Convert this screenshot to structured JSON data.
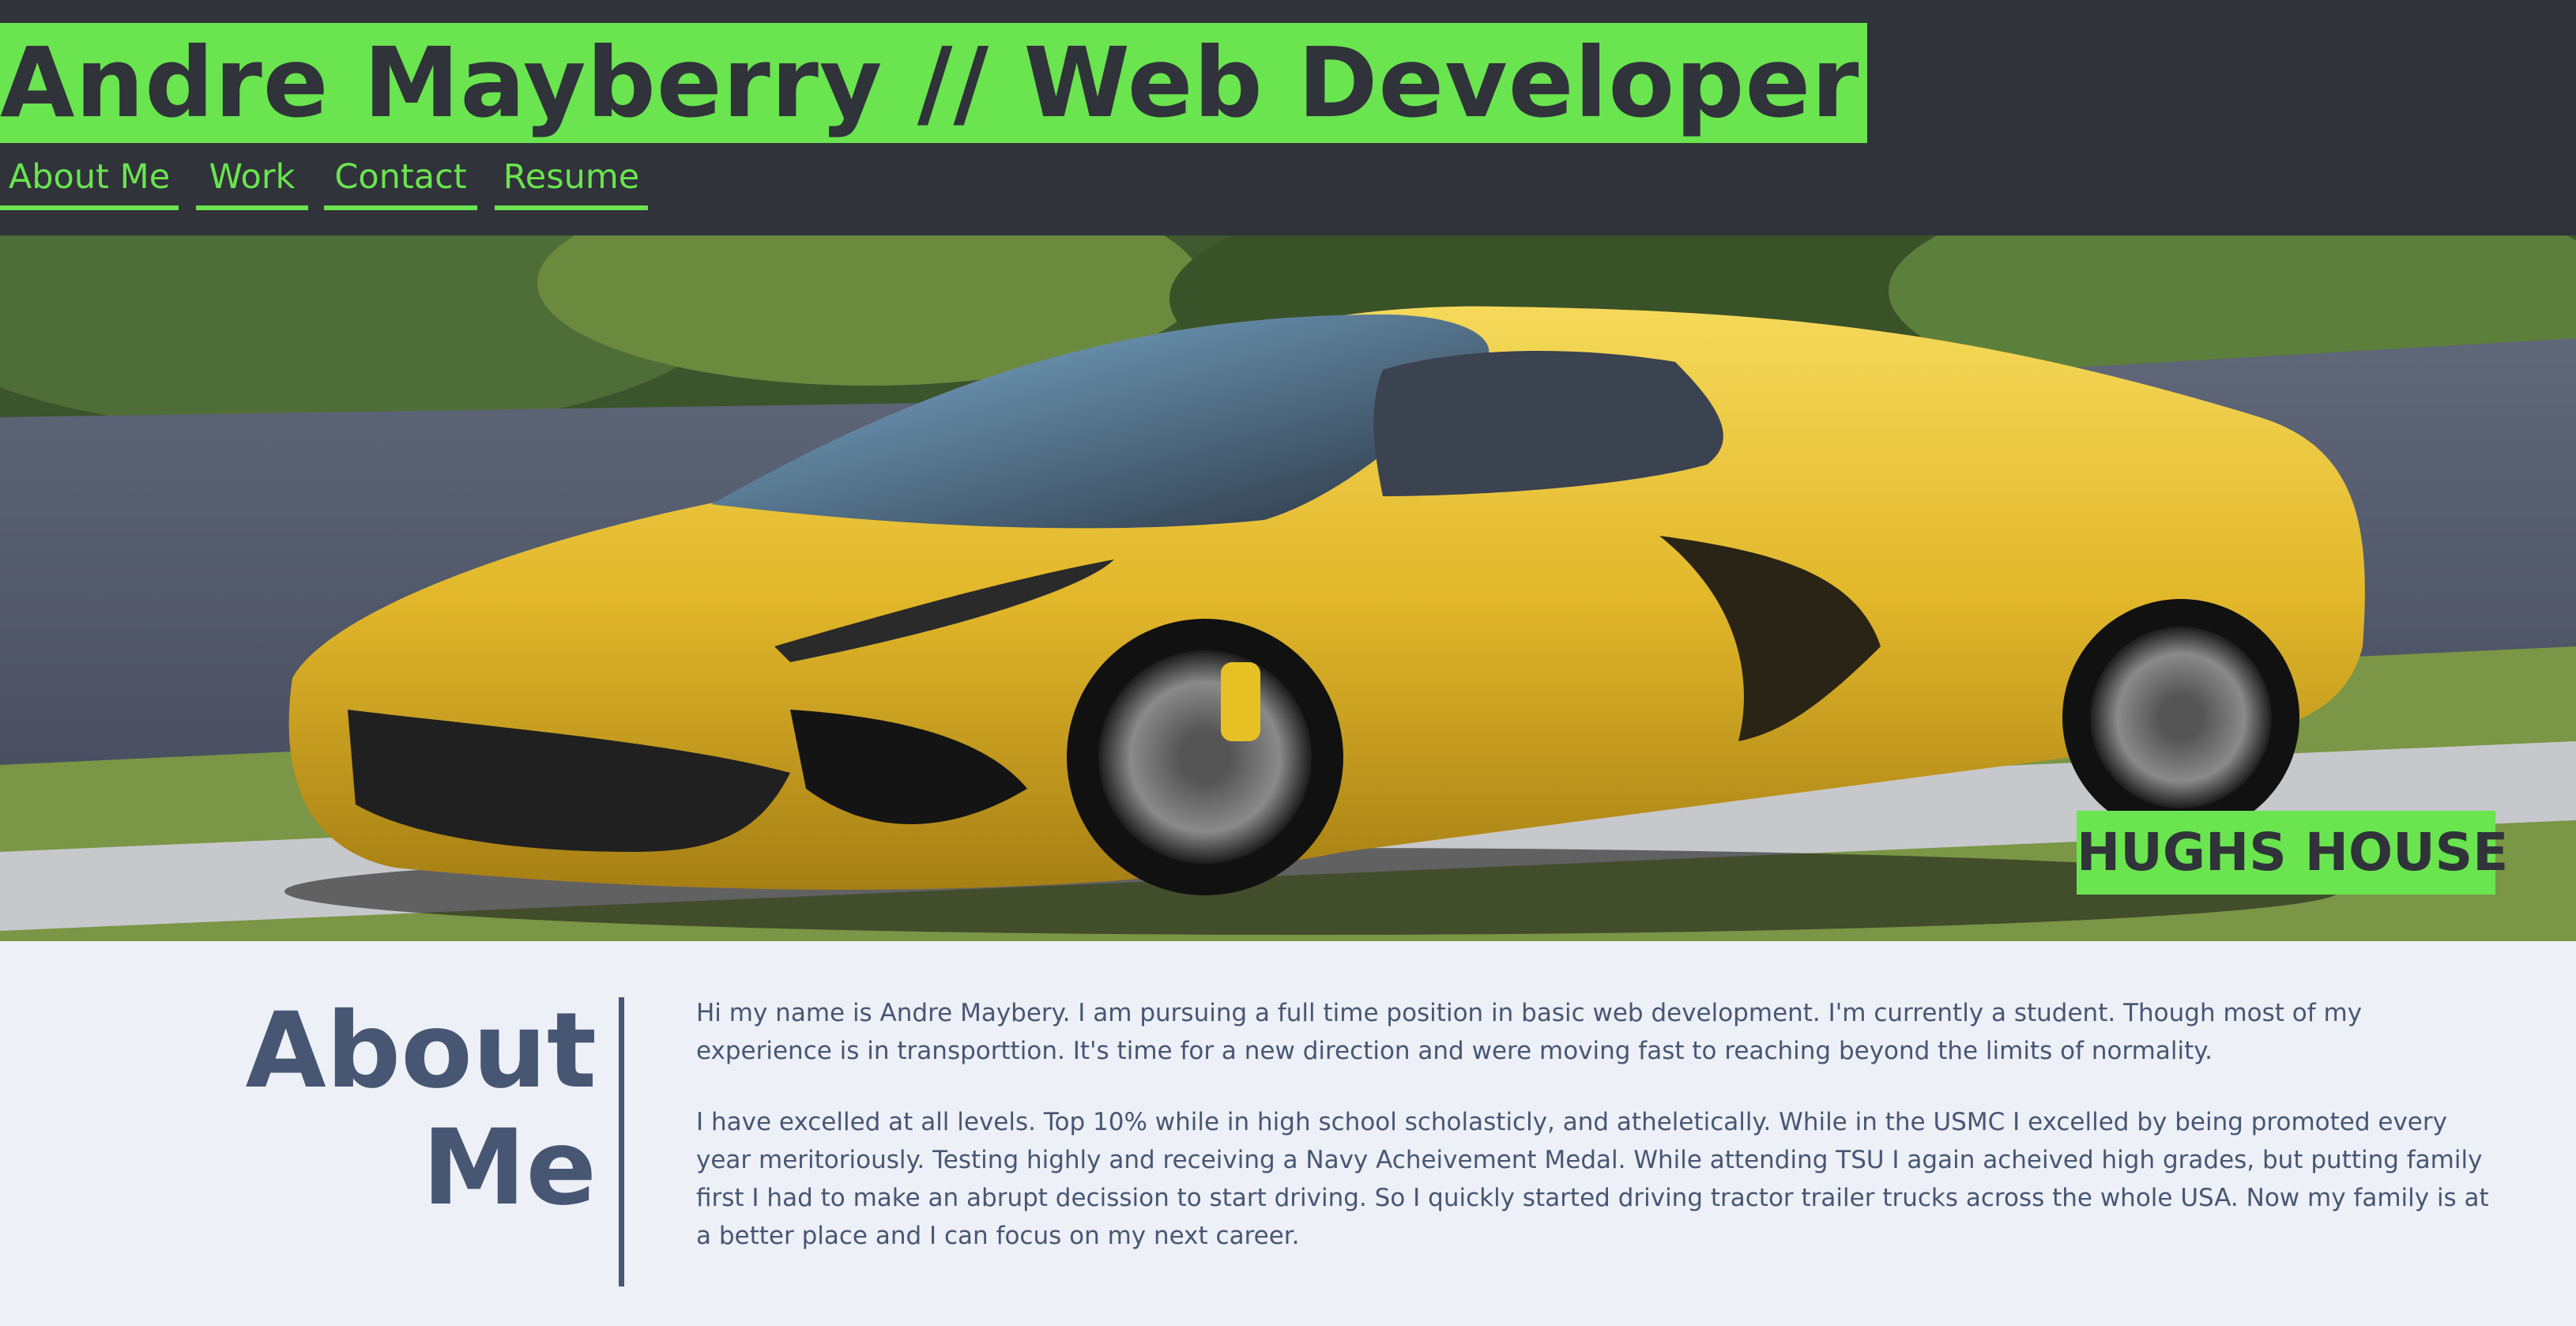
{
  "header": {
    "title": "Andre Mayberry // Web Developer",
    "nav": [
      {
        "label": "About Me"
      },
      {
        "label": "Work"
      },
      {
        "label": "Contact"
      },
      {
        "label": "Resume"
      }
    ]
  },
  "hero": {
    "image": "yellow-sports-car-photo",
    "badge": "HUGHS HOUSE"
  },
  "about": {
    "heading_line1": "About",
    "heading_line2": "Me",
    "paragraphs": [
      "Hi my name is Andre Maybery. I am pursuing a full time position in basic web development. I'm currently a student. Though most of my experience is in transporttion. It's time for a new direction and were moving fast to reaching beyond the limits of normality.",
      "I have excelled at all levels. Top 10% while in high school scholasticly, and atheletically. While in the USMC I excelled by being promoted every year meritoriously. Testing highly and receiving a Navy Acheivement Medal. While attending TSU I again acheived high grades, but putting family first I had to make an abrupt decission to start driving. So I quickly started driving tractor trailer trucks across the whole USA. Now my family is at a better place and I can focus on my next career."
    ]
  },
  "colors": {
    "accent": "#6ae44f",
    "header_bg": "#30333a",
    "page_bg": "#eef0f7",
    "text": "#475673"
  }
}
